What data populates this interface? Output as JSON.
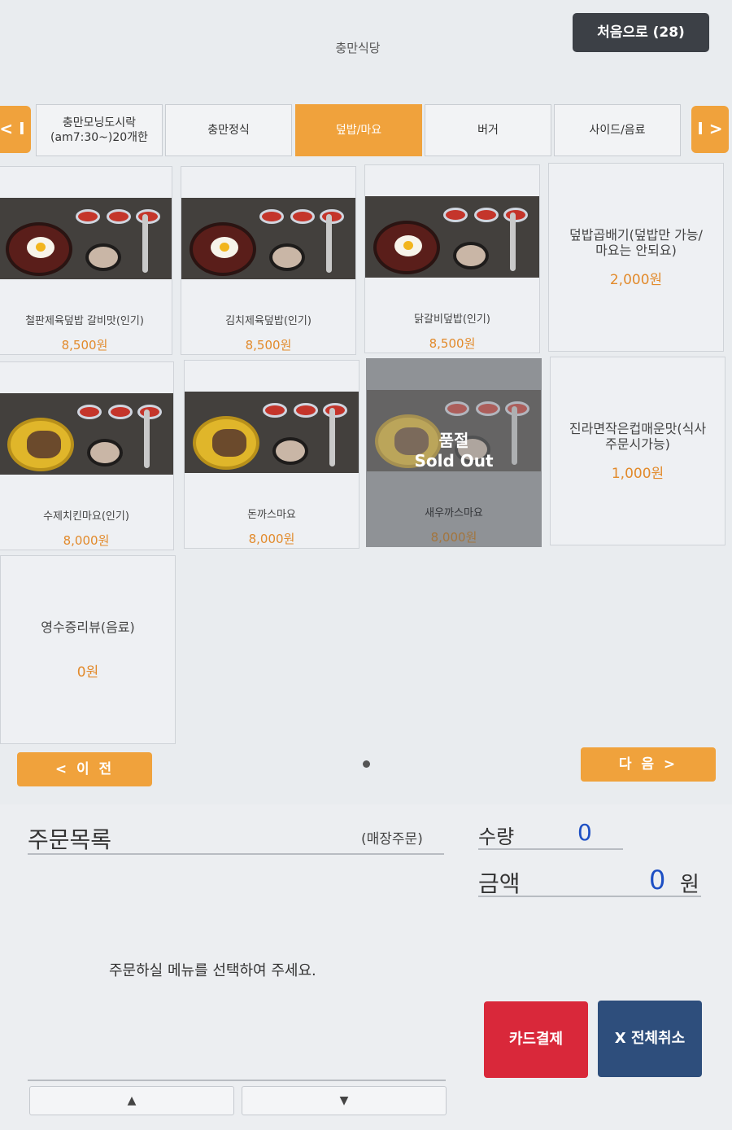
{
  "header": {
    "store_name": "충만식당",
    "home_button": "처음으로 (28)"
  },
  "categories": {
    "prev": "< I",
    "next": "I >",
    "tabs": [
      {
        "label": "충만모닝도시락\n(am7:30~)20개한"
      },
      {
        "label": "충만정식"
      },
      {
        "label": "덮밥/마요"
      },
      {
        "label": "버거"
      },
      {
        "label": "사이드/음료"
      }
    ],
    "active_index": 2
  },
  "menu": {
    "items": [
      {
        "name": "철판제육덮밥 갈비맛(인기)",
        "price": "8,500원"
      },
      {
        "name": "김치제육덮밥(인기)",
        "price": "8,500원"
      },
      {
        "name": "닭갈비덮밥(인기)",
        "price": "8,500원"
      },
      {
        "name": "덮밥곱배기(덮밥만 가능/\n마요는 안되요)",
        "price": "2,000원"
      },
      {
        "name": "수제치킨마요(인기)",
        "price": "8,000원"
      },
      {
        "name": "돈까스마요",
        "price": "8,000원"
      },
      {
        "name": "새우까스마요",
        "price": "8,000원",
        "soldout_kr": "품절",
        "soldout_en": "Sold Out"
      },
      {
        "name": "진라면작은컵매운맛(식사\n주문시가능)",
        "price": "1,000원"
      },
      {
        "name": "영수증리뷰(음료)",
        "price": "0원"
      }
    ]
  },
  "pagination": {
    "prev": "<  이 전",
    "next": "다 음  >"
  },
  "order": {
    "title": "주문목록",
    "type": "(매장주문)",
    "qty_label": "수량",
    "qty_value": "0",
    "amount_label": "금액",
    "amount_value": "0",
    "amount_unit": "원",
    "hint": "주문하실 메뉴를 선택하여 주세요.",
    "pay_button": "카드결제",
    "cancel_button": "X 전체취소",
    "scroll_up": "▲",
    "scroll_down": "▼"
  },
  "colors": {
    "accent": "#f0a23c",
    "price": "#e28a2b",
    "pay": "#d9283a",
    "cancel": "#2e4e7c",
    "value": "#1d4fc4"
  }
}
